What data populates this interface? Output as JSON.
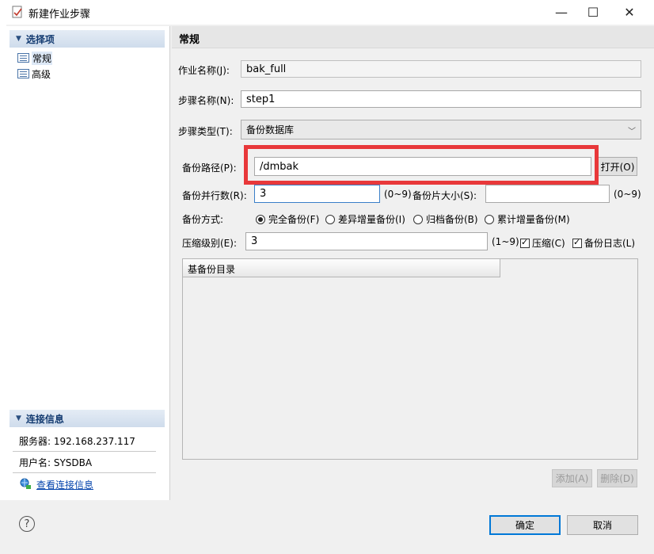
{
  "window": {
    "title": "新建作业步骤",
    "minimize_glyph": "—",
    "maximize_glyph": "☐",
    "close_glyph": "✕"
  },
  "left": {
    "options_header": "选择项",
    "items": [
      {
        "label": "常规"
      },
      {
        "label": "高级"
      }
    ],
    "conn_header": "连接信息",
    "server": "服务器: 192.168.237.117",
    "user": "用户名: SYSDBA",
    "view_link": "查看连接信息"
  },
  "main": {
    "section_title": "常规",
    "job_name_label": "作业名称(J):",
    "job_name_value": "bak_full",
    "step_name_label": "步骤名称(N):",
    "step_name_value": "step1",
    "step_type_label": "步骤类型(T):",
    "step_type_value": "备份数据库",
    "backup_path_label": "备份路径(P):",
    "backup_path_value": "/dmbak",
    "open_button": "打开(O)",
    "parallel_label": "备份并行数(R):",
    "parallel_value": "3",
    "parallel_range": "(0~9)",
    "piece_size_label": "备份片大小(S):",
    "piece_size_value": "",
    "piece_size_range": "(0~9)",
    "mode_label": "备份方式:",
    "modes": [
      {
        "label": "完全备份(F)",
        "selected": true
      },
      {
        "label": "差异增量备份(I)",
        "selected": false
      },
      {
        "label": "归档备份(B)",
        "selected": false
      },
      {
        "label": "累计增量备份(M)",
        "selected": false
      }
    ],
    "compress_label": "压缩级别(E):",
    "compress_value": "3",
    "compress_range": "(1~9)",
    "compress_check": {
      "label": "压缩(C)",
      "checked": true
    },
    "log_check": {
      "label": "备份日志(L)",
      "checked": true
    },
    "table_column": "基备份目录",
    "add_button": "添加(A)",
    "delete_button": "删除(D)"
  },
  "footer": {
    "help_glyph": "?",
    "ok_button": "确定",
    "cancel_button": "取消"
  },
  "colors": {
    "highlight": "#e8383a",
    "accent": "#0078d7",
    "link": "#0645ad"
  },
  "icons": [
    "app-icon",
    "collapse-triangle-icon",
    "page-icon",
    "connection-info-icon",
    "help-icon",
    "dropdown-arrow-icon"
  ]
}
